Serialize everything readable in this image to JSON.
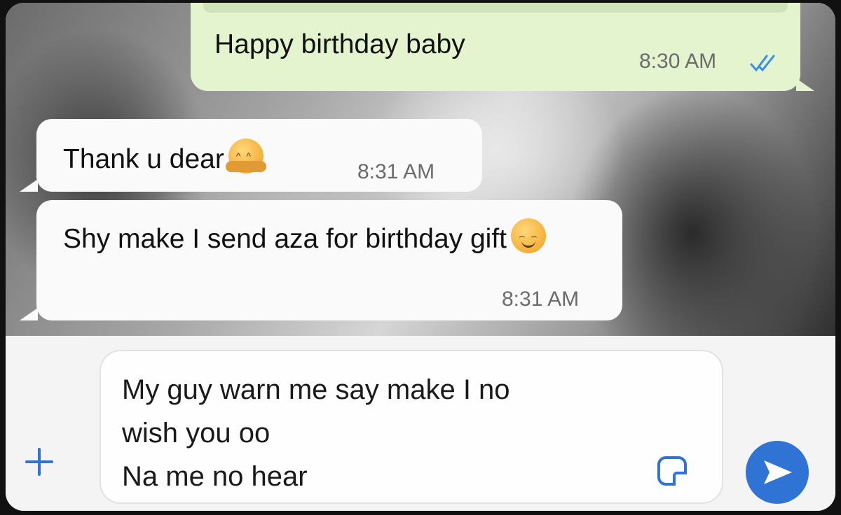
{
  "messages": [
    {
      "direction": "outgoing",
      "text": "Happy birthday baby",
      "time": "8:30 AM",
      "status": "read",
      "status_icon": "double-check-icon"
    },
    {
      "direction": "incoming",
      "text": "Thank u dear",
      "emoji": "hugging-face-emoji",
      "time": "8:31 AM"
    },
    {
      "direction": "incoming",
      "text": "Shy make I send aza for birthday gift",
      "emoji": "smiling-face-emoji",
      "time": "8:31 AM"
    }
  ],
  "composer": {
    "draft_text": "My guy warn me say make I no\nwish you oo\nNa me no hear",
    "attach_icon": "plus-icon",
    "sticker_icon": "sticker-icon",
    "send_icon": "send-icon"
  },
  "colors": {
    "outgoing_bubble": "#e3f4cf",
    "incoming_bubble": "#fafafa",
    "accent": "#2f73d4",
    "read_check": "#3b8fe8"
  }
}
